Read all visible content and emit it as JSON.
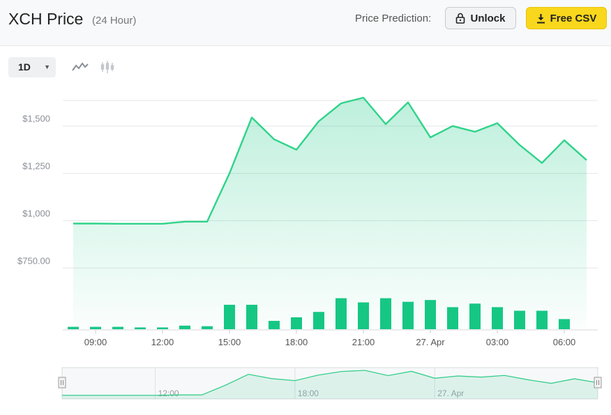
{
  "header": {
    "title": "XCH Price",
    "subtitle": "(24 Hour)",
    "prediction_label": "Price Prediction:",
    "unlock_label": "Unlock",
    "csv_label": "Free CSV"
  },
  "controls": {
    "range_value": "1D",
    "line_icon": "line-chart-icon",
    "candle_icon": "candlestick-chart-icon"
  },
  "colors": {
    "line": "#2fd389",
    "fill": "#16c784",
    "volume": "#16c784",
    "csv_button": "#f9d71c"
  },
  "chart_data": {
    "type": "area",
    "title": "XCH Price",
    "xlabel": "",
    "ylabel": "",
    "y_ticks": [
      750,
      1000,
      1250,
      1500
    ],
    "y_tick_labels": [
      "$750.00",
      "$1,000",
      "$1,250",
      "$1,500"
    ],
    "ylim": [
      600,
      1650
    ],
    "x_ticks": [
      1,
      4,
      7,
      10,
      13,
      16,
      19,
      22
    ],
    "x_tick_labels": [
      "09:00",
      "12:00",
      "15:00",
      "18:00",
      "21:00",
      "27. Apr",
      "03:00",
      "06:00"
    ],
    "x": [
      0,
      1,
      2,
      3,
      4,
      5,
      6,
      7,
      8,
      9,
      10,
      11,
      12,
      13,
      14,
      15,
      16,
      17,
      18,
      19,
      20,
      21,
      22,
      23
    ],
    "series": [
      {
        "values": [
          985,
          985,
          984,
          984,
          984,
          995,
          995,
          1250,
          1545,
          1430,
          1375,
          1525,
          1620,
          1650,
          1510,
          1625,
          1440,
          1500,
          1470,
          1515,
          1400,
          1305,
          1425,
          1320
        ]
      }
    ],
    "volume": [
      4,
      4,
      4,
      3,
      3,
      6,
      5,
      41,
      41,
      14,
      20,
      29,
      52,
      45,
      52,
      46,
      49,
      37,
      43,
      37,
      31,
      31,
      17
    ],
    "grid": true,
    "navigator": {
      "labels": [
        "12:00",
        "18:00",
        "27. Apr"
      ],
      "label_positions": [
        4,
        10,
        16
      ]
    }
  }
}
